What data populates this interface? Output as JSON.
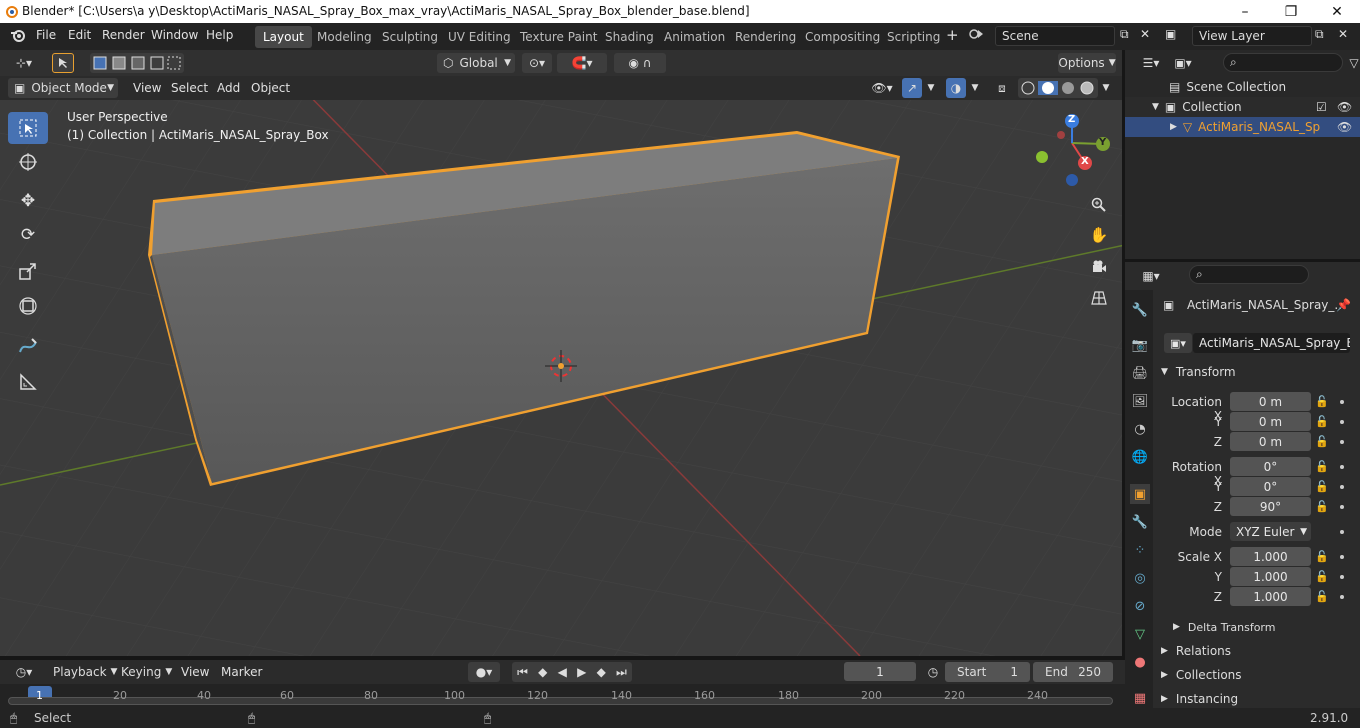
{
  "titlebar": {
    "title": "Blender* [C:\\Users\\a y\\Desktop\\ActiMaris_NASAL_Spray_Box_max_vray\\ActiMaris_NASAL_Spray_Box_blender_base.blend]",
    "minimize": "–",
    "maximize": "❐",
    "close": "✕"
  },
  "menu": {
    "file": "File",
    "edit": "Edit",
    "render": "Render",
    "window": "Window",
    "help": "Help"
  },
  "workspaces": [
    "Layout",
    "Modeling",
    "Sculpting",
    "UV Editing",
    "Texture Paint",
    "Shading",
    "Animation",
    "Rendering",
    "Compositing",
    "Scripting"
  ],
  "scene": {
    "name": "Scene",
    "view_layer": "View Layer"
  },
  "viewport_header": {
    "mode": "Object Mode",
    "view": "View",
    "select": "Select",
    "add": "Add",
    "object": "Object",
    "transform_orientation": "Global",
    "options": "Options"
  },
  "viewport": {
    "perspective": "User Perspective",
    "collection_info": "(1) Collection | ActiMaris_NASAL_Spray_Box",
    "gizmo_x": "X",
    "gizmo_y": "Y",
    "gizmo_z": "Z"
  },
  "outliner": {
    "scene_collection": "Scene Collection",
    "collection": "Collection",
    "object": "ActiMaris_NASAL_Sp"
  },
  "properties": {
    "object_title": "ActiMaris_NASAL_Spray_...",
    "object_name": "ActiMaris_NASAL_Spray_Box",
    "transform": "Transform",
    "location_label": "Location X",
    "y_label": "Y",
    "z_label": "Z",
    "rotation_label": "Rotation X",
    "scale_label": "Scale X",
    "loc_x": "0 m",
    "loc_y": "0 m",
    "loc_z": "0 m",
    "rot_x": "0°",
    "rot_y": "0°",
    "rot_z": "90°",
    "mode_label": "Mode",
    "mode_value": "XYZ Euler",
    "scale_x": "1.000",
    "scale_y": "1.000",
    "scale_z": "1.000",
    "delta_transform": "Delta Transform",
    "relations": "Relations",
    "collections": "Collections",
    "instancing": "Instancing"
  },
  "timeline": {
    "playback": "Playback",
    "keying": "Keying",
    "view": "View",
    "marker": "Marker",
    "current_frame": "1",
    "start_label": "Start",
    "start": "1",
    "end_label": "End",
    "end": "250",
    "ticks": [
      "1",
      "20",
      "40",
      "60",
      "80",
      "100",
      "120",
      "140",
      "160",
      "180",
      "200",
      "220",
      "240"
    ]
  },
  "statusbar": {
    "select": "Select",
    "version": "2.91.0"
  },
  "colors": {
    "accent": "#4772b3",
    "selection_outline": "#f0a030",
    "viewport_bg": "#3a3a3a"
  }
}
